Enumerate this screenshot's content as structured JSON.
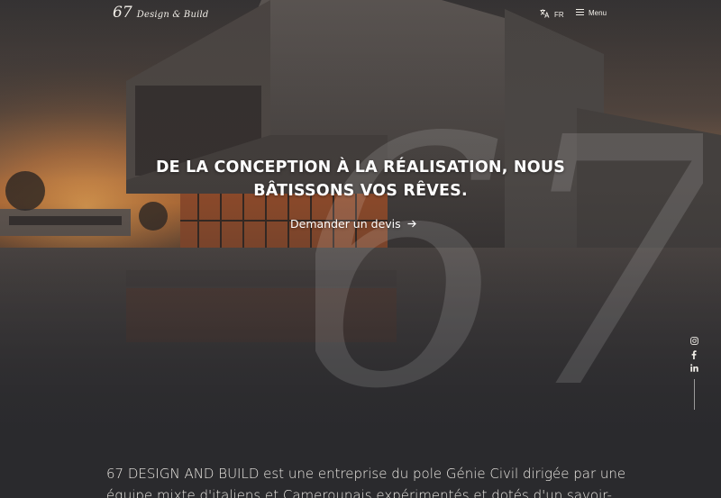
{
  "header": {
    "logo_number": "67",
    "logo_text": "Design & Build",
    "language_label": "FR",
    "menu_label": "Menu"
  },
  "hero": {
    "headline_line1": "DE LA CONCEPTION À LA RÉALISATION, NOUS",
    "headline_line2": "BÂTISSONS VOS RÊVES.",
    "cta_label": "Demander un devis",
    "watermark": "67"
  },
  "social": {
    "icons": [
      "instagram-icon",
      "facebook-icon",
      "linkedin-icon"
    ]
  },
  "intro": {
    "line1": "67 DESIGN AND BUILD est une entreprise du pole Génie Civil  dirigée par une",
    "line2": "équipe mixte d'italiens et Camerounais expérimentés et dotés d'un savoir-"
  },
  "colors": {
    "background": "#2a2a2d",
    "text": "#ffffff",
    "muted_text": "#ece9e4"
  }
}
